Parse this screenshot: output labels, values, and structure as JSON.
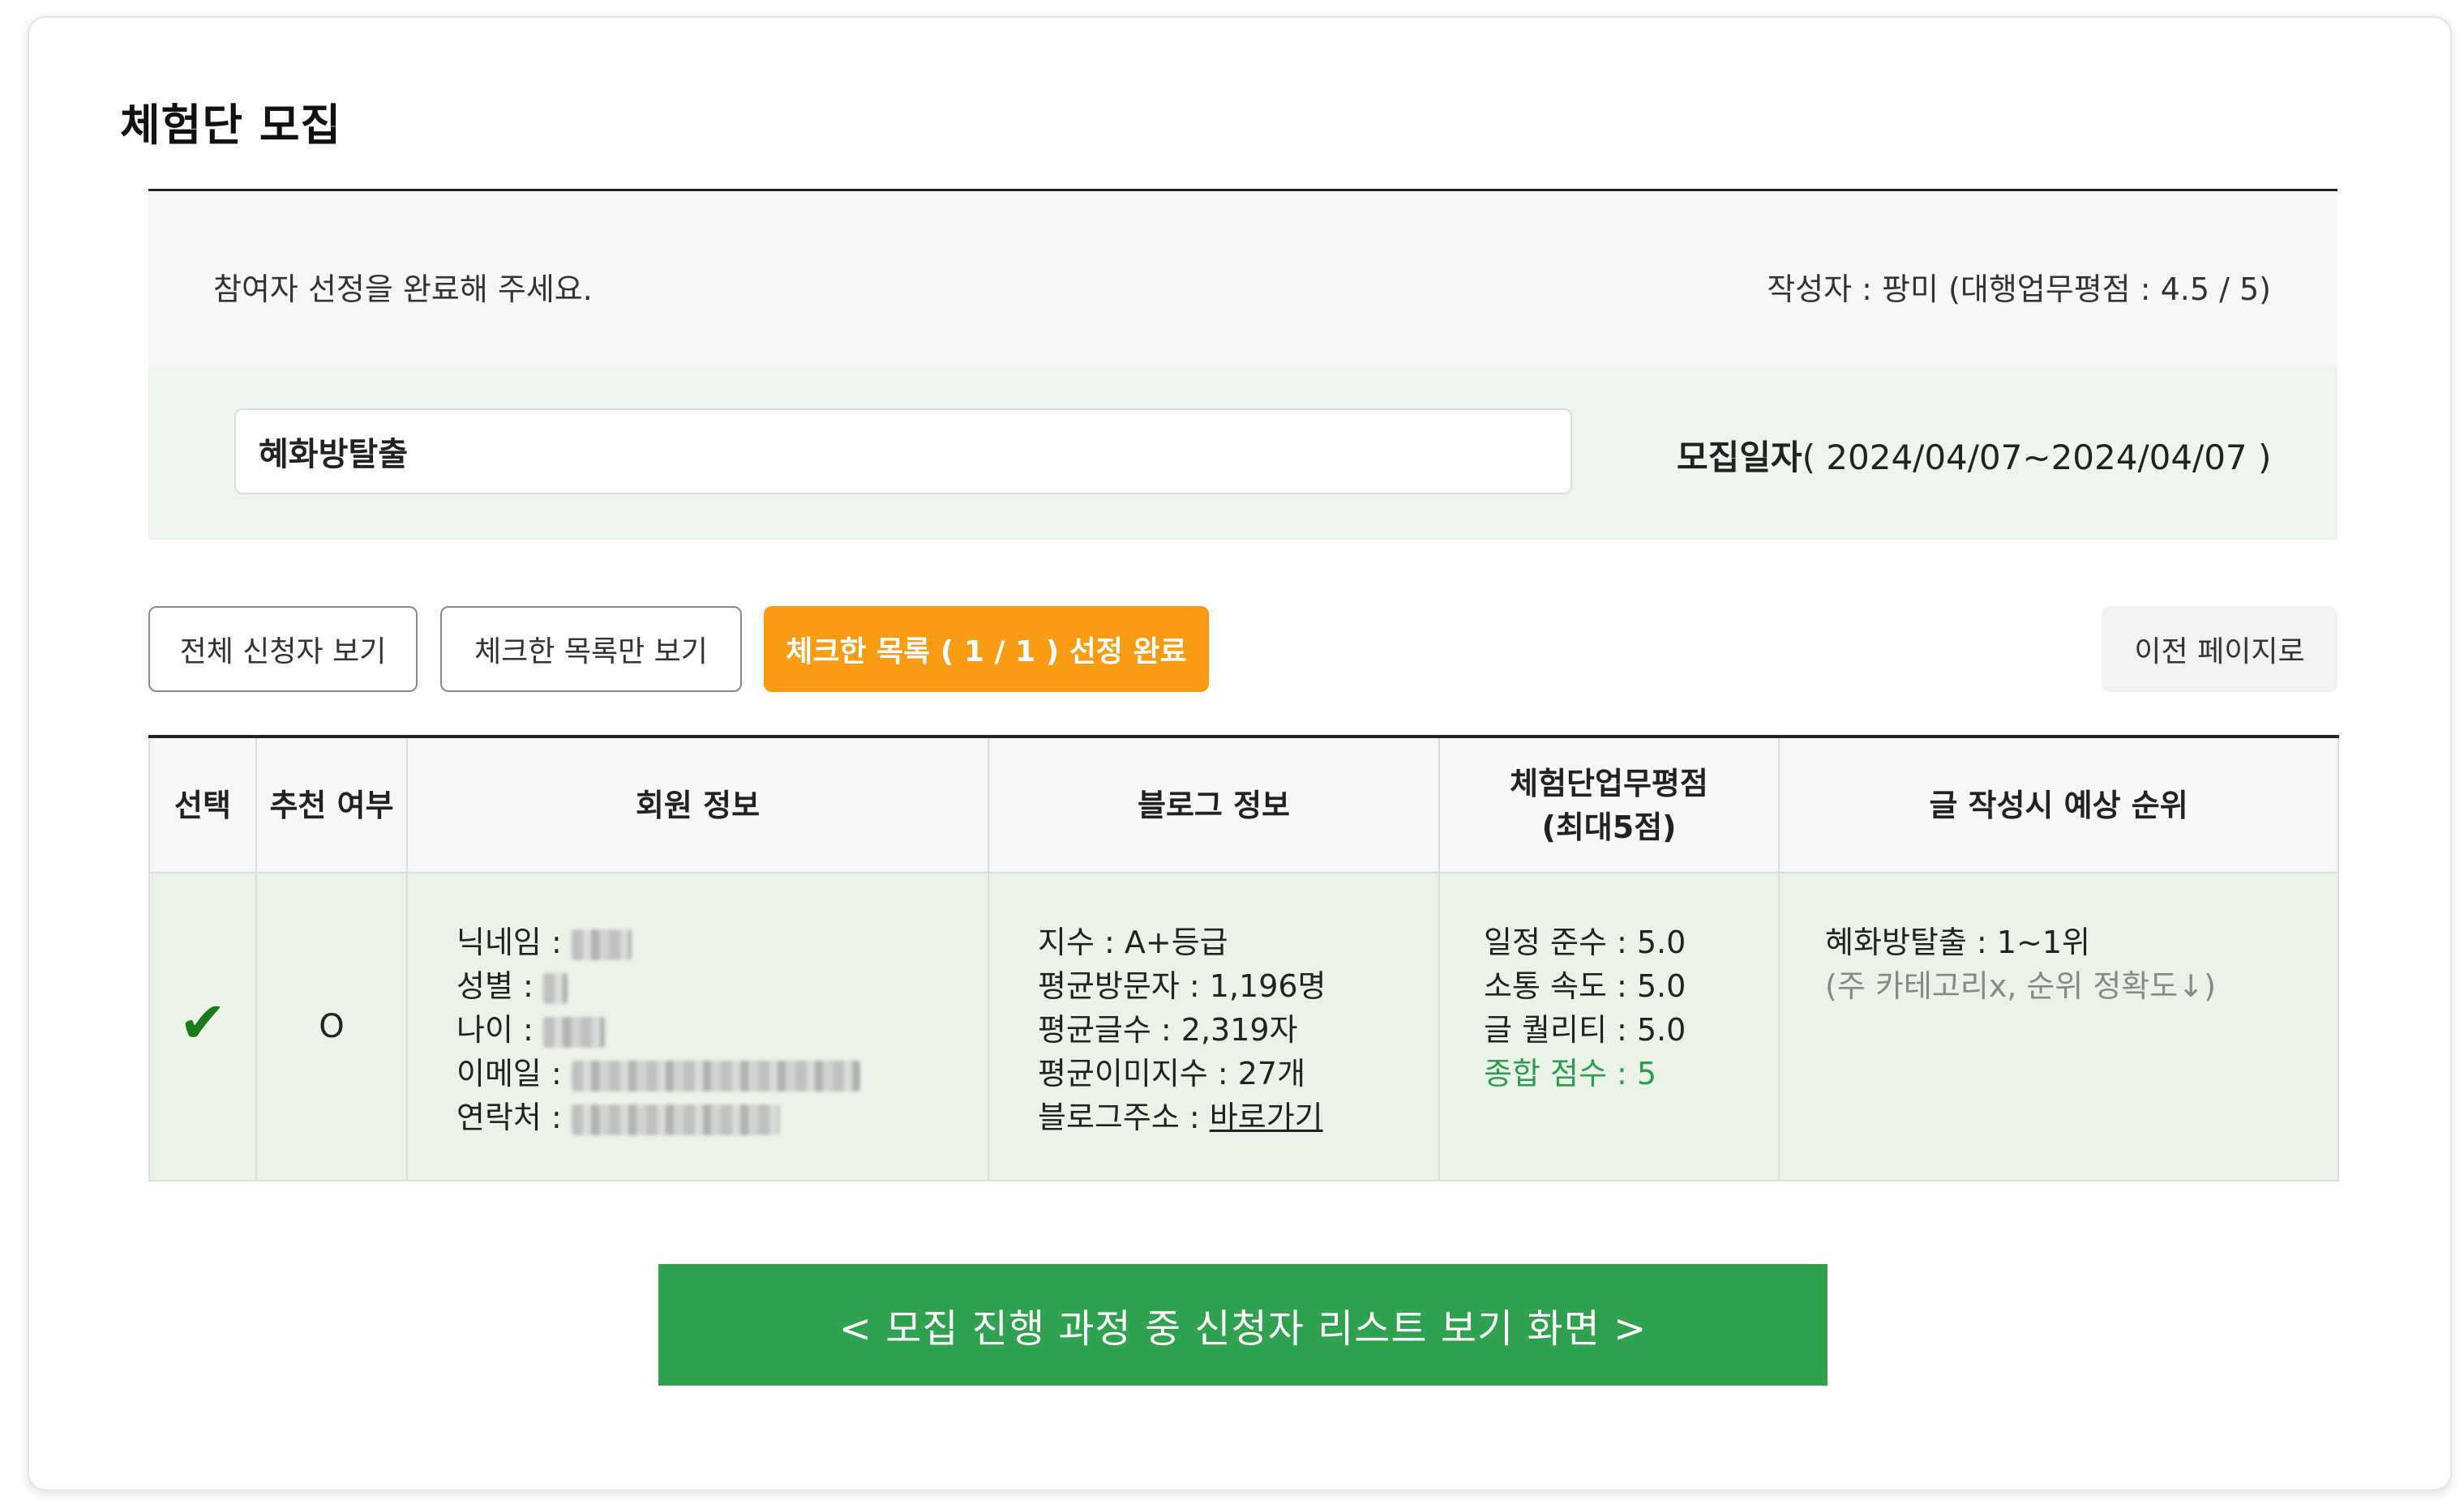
{
  "page_title": "체험단 모집",
  "info": {
    "message": "참여자 선정을 완료해 주세요.",
    "author": "작성자 : 팡미 (대행업무평점 : 4.5 / 5)"
  },
  "search": {
    "value": "혜화방탈출",
    "recruit_label": "모집일자",
    "recruit_range": "( 2024/04/07~2024/04/07 )"
  },
  "buttons": {
    "all": "전체 신청자 보기",
    "checked_only": "체크한 목록만 보기",
    "complete": "체크한 목록 ( 1 / 1 ) 선정 완료",
    "prev": "이전 페이지로"
  },
  "table": {
    "headers": [
      "선택",
      "추천 여부",
      "회원 정보",
      "블로그 정보",
      "체험단업무평점",
      "(최대5점)",
      "글 작성시 예상 순위"
    ],
    "rows": [
      {
        "selected_icon": "checkmark-icon",
        "recommend": "O",
        "member": {
          "nickname_label": "닉네임 :",
          "gender_label": "성별 :",
          "age_label": "나이 :",
          "email_label": "이메일 :",
          "phone_label": "연락처 :"
        },
        "blog": {
          "index": "지수 : A+등급",
          "avg_visitors": "평균방문자 : 1,196명",
          "avg_chars": "평균글수 : 2,319자",
          "avg_images": "평균이미지수 : 27개",
          "address_label": "블로그주소 :",
          "address_link": "바로가기"
        },
        "score": {
          "schedule": "일정 준수 : 5.0",
          "communication": "소통 속도 : 5.0",
          "quality": "글 퀄리티 : 5.0",
          "total": "종합 점수 : 5"
        },
        "rank": {
          "keyword_rank": "혜화방탈출 : 1~1위",
          "note": "(주 카테고리x, 순위 정확도↓)"
        }
      }
    ]
  },
  "caption": "< 모집 진행 과정 중 신청자 리스트 보기 화면 >",
  "colors": {
    "accent_orange": "#f99b13",
    "caption_green": "#2fa24f",
    "row_bg": "#ebf3e8",
    "total_green": "#2e9c4f"
  }
}
